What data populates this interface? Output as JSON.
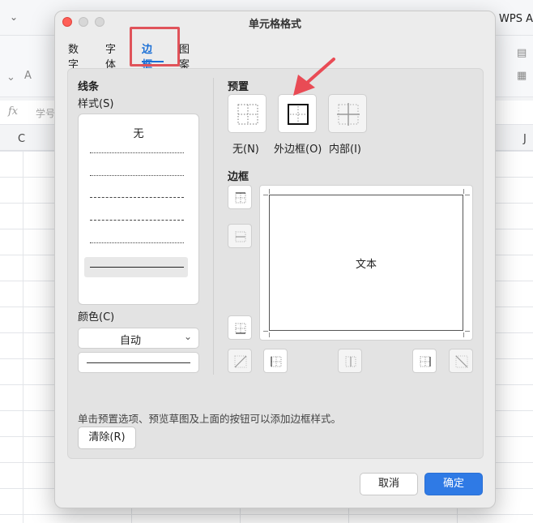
{
  "background": {
    "wps_label": "WPS A",
    "fx_label": "fx",
    "namebox_text": "学号",
    "col_c": "C",
    "col_j": "J"
  },
  "dialog": {
    "title": "单元格格式",
    "tabs": [
      {
        "label": "数字",
        "active": false
      },
      {
        "label": "字体",
        "active": false
      },
      {
        "label": "边框",
        "active": true
      },
      {
        "label": "图案",
        "active": false
      }
    ],
    "line": {
      "section_label": "线条",
      "style_label": "样式(S)",
      "style_none": "无",
      "styles": [
        "dotted-fine",
        "dotted",
        "dash-dot",
        "dash-dot-dot",
        "dotted-sparse",
        "solid-thin"
      ],
      "selected_style": "solid-thin",
      "color_label": "颜色(C)",
      "color_value": "自动"
    },
    "presets": {
      "section_label": "预置",
      "items": [
        {
          "label": "无(N)",
          "icon": "preset-none-icon"
        },
        {
          "label": "外边框(O)",
          "icon": "preset-outline-icon"
        },
        {
          "label": "内部(I)",
          "icon": "preset-inside-icon"
        }
      ]
    },
    "border": {
      "section_label": "边框",
      "preview_text": "文本"
    },
    "hint": "单击预置选项、预览草图及上面的按钮可以添加边框样式。",
    "clear_button": "清除(R)",
    "cancel_button": "取消",
    "ok_button": "确定"
  },
  "colors": {
    "accent": "#1a6fd6",
    "primary_button": "#2f7ae5",
    "highlight_box": "#e0535a",
    "annotation_arrow": "#e94b55"
  }
}
